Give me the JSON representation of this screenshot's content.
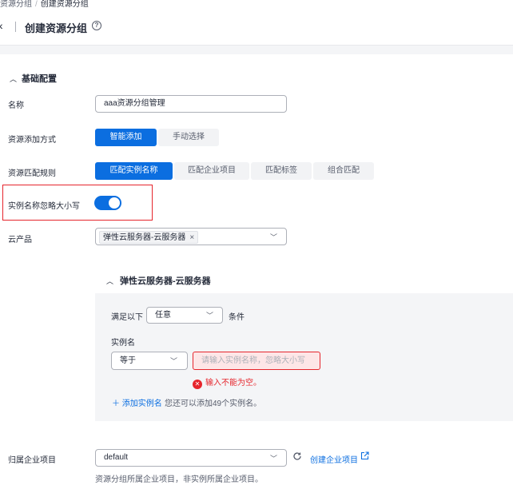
{
  "breadcrumb": {
    "parent": "资源分组",
    "separator": "/",
    "current": "创建资源分组"
  },
  "header": {
    "back_icon": "chevron-left-icon",
    "title": "创建资源分组",
    "help_icon": "question-circle-icon"
  },
  "section": {
    "title": "基础配置",
    "collapse_icon": "chevron-up-icon"
  },
  "form": {
    "name": {
      "label": "名称",
      "value": "aaa资源分组管理"
    },
    "add_method": {
      "label": "资源添加方式",
      "options": [
        "智能添加",
        "手动选择"
      ],
      "selected": "智能添加"
    },
    "match_rule": {
      "label": "资源匹配规则",
      "options": [
        "匹配实例名称",
        "匹配企业项目",
        "匹配标签",
        "组合匹配"
      ],
      "selected": "匹配实例名称"
    },
    "ignore_case": {
      "label": "实例名称忽略大小写",
      "enabled": true
    },
    "cloud_product": {
      "label": "云产品",
      "tag": "弹性云服务器-云服务器",
      "tag_close": "×"
    },
    "enterprise_project": {
      "label": "归属企业项目",
      "value": "default",
      "create_link": "创建企业项目",
      "hint": "资源分组所属企业项目，非实例所属企业项目。"
    }
  },
  "product_panel": {
    "title": "弹性云服务器-云服务器",
    "condition_prefix": "满足以下",
    "condition_value": "任意",
    "condition_suffix": "条件",
    "instance_label": "实例名",
    "operator": "等于",
    "instance_placeholder": "请输入实例名称，忽略大小写",
    "error": "输入不能为空。",
    "add_link": "＋ 添加实例名",
    "add_hint": "您还可以添加49个实例名。"
  },
  "colors": {
    "primary": "#0b6ee0",
    "error": "#e6252c",
    "panel_bg": "#f4f5f7"
  }
}
